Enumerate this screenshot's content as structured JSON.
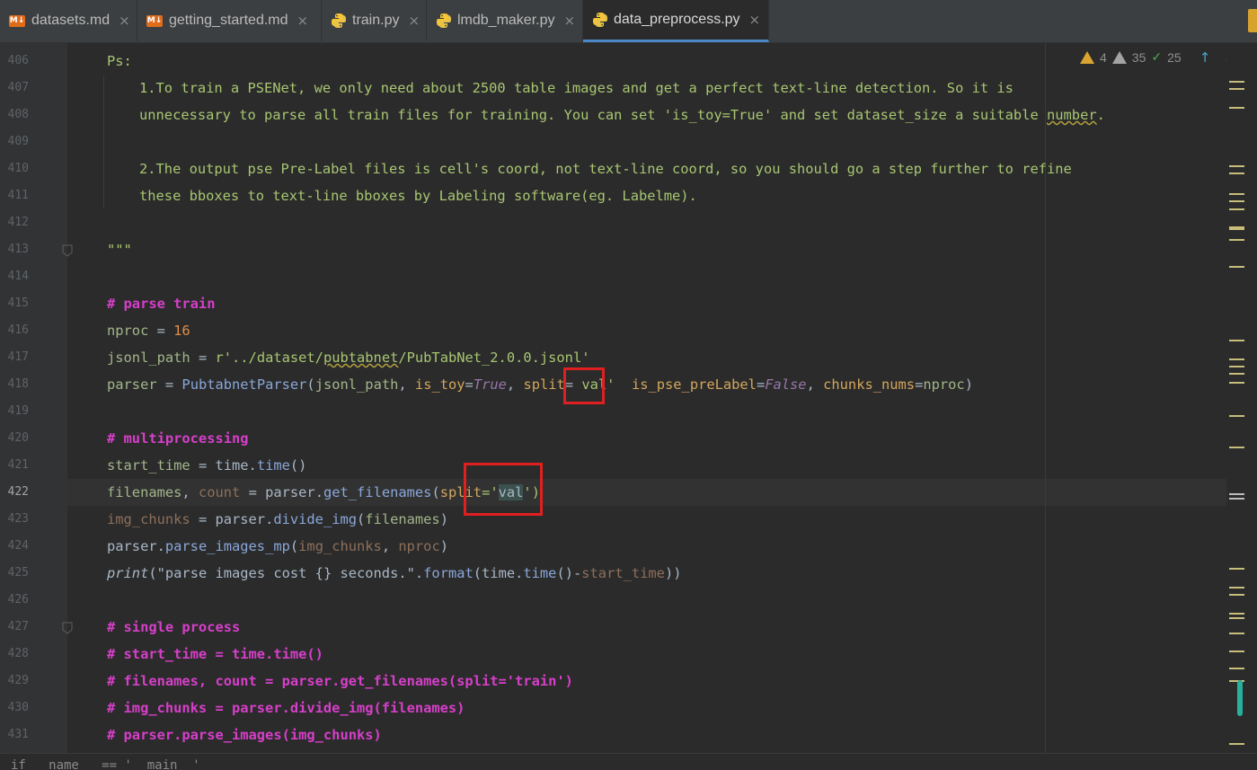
{
  "tabs": [
    {
      "label": "datasets.md",
      "icon": "markdown-icon"
    },
    {
      "label": "getting_started.md",
      "icon": "markdown-icon"
    },
    {
      "label": "train.py",
      "icon": "python-icon"
    },
    {
      "label": "lmdb_maker.py",
      "icon": "python-icon"
    },
    {
      "label": "data_preprocess.py",
      "icon": "python-icon",
      "active": true
    }
  ],
  "md_badge": "M↓",
  "close_glyph": "×",
  "inspection": {
    "warnings": "4",
    "weak_warnings": "35",
    "ok": "25"
  },
  "line_numbers": [
    "406",
    "407",
    "408",
    "409",
    "410",
    "411",
    "412",
    "413",
    "414",
    "415",
    "416",
    "417",
    "418",
    "419",
    "420",
    "421",
    "422",
    "423",
    "424",
    "425",
    "426",
    "427",
    "428",
    "429",
    "430",
    "431"
  ],
  "code": {
    "l406": "Ps:",
    "l407": "1.To train a PSENet, we only need about 2500 table images and get a perfect text-line detection. So it is",
    "l408a": "unnecessary to parse all train files for training. You can set 'is_toy=True' and set dataset_size a suitable ",
    "l408b": "number",
    "l408c": ".",
    "l410": "2.The output pse Pre-Label files is cell's coord, not text-line coord, so you should go a step further to refine",
    "l411": "these bboxes to text-line bboxes by Labeling software(eg. Labelme).",
    "l413": "\"\"\"",
    "l415": "# parse train",
    "l416_var": "nproc",
    "l416_op": " = ",
    "l416_num": "16",
    "l417_var": "jsonl_path",
    "l417_op": " = ",
    "l417_s1": "r'../dataset/",
    "l417_s2": "pubtabnet",
    "l417_s3": "/PubTabNet_2.0.0.jsonl'",
    "l418_var": "parser",
    "l418_op": " = ",
    "l418_cls": "PubtabnetParser",
    "l418_a": "(",
    "l418_b": "jsonl_path",
    "l418_c": ", ",
    "l418_d": "is_toy",
    "l418_e": "=",
    "l418_f": "True",
    "l418_g": ", ",
    "l418_h": "split",
    "l418_i": "= ",
    "l418_j": "val'",
    "l418_k": "  ",
    "l418_l": "is_pse_preLabel",
    "l418_m": "=",
    "l418_n": "False",
    "l418_o": ", ",
    "l418_p": "chunks_nums",
    "l418_q": "=",
    "l418_r": "nproc",
    "l418_s": ")",
    "l420": "# multiprocessing",
    "l421_a": "start_time",
    "l421_b": " = time.",
    "l421_c": "time",
    "l421_d": "()",
    "l422_a": "filenames",
    "l422_b": ", ",
    "l422_c": "count",
    "l422_d": " = parser.",
    "l422_e": "get_filenames",
    "l422_f": "(",
    "l422_g": "split",
    "l422_h": "='",
    "l422_i": "val",
    "l422_j": "')",
    "l423_a": "img_chunks",
    "l423_b": " = parser.",
    "l423_c": "divide_img",
    "l423_d": "(",
    "l423_e": "filenames",
    "l423_f": ")",
    "l424_a": "parser.",
    "l424_b": "parse_images_mp",
    "l424_c": "(",
    "l424_d": "img_chunks",
    "l424_e": ", ",
    "l424_f": "nproc",
    "l424_g": ")",
    "l425_a": "print",
    "l425_b": "(",
    "l425_c": "\"parse images cost {} seconds.\"",
    "l425_d": ".",
    "l425_e": "format",
    "l425_f": "(time.",
    "l425_g": "time",
    "l425_h": "()-",
    "l425_i": "start_time",
    "l425_j": "))",
    "l427": "# single process",
    "l428": "# start_time = time.time()",
    "l429": "# filenames, count = parser.get_filenames(split='train')",
    "l430": "# img_chunks = parser.divide_img(filenames)",
    "l431": "# parser.parse_images(img_chunks)"
  },
  "bottom_breadcrumb": "if __name__ == '__main__'"
}
